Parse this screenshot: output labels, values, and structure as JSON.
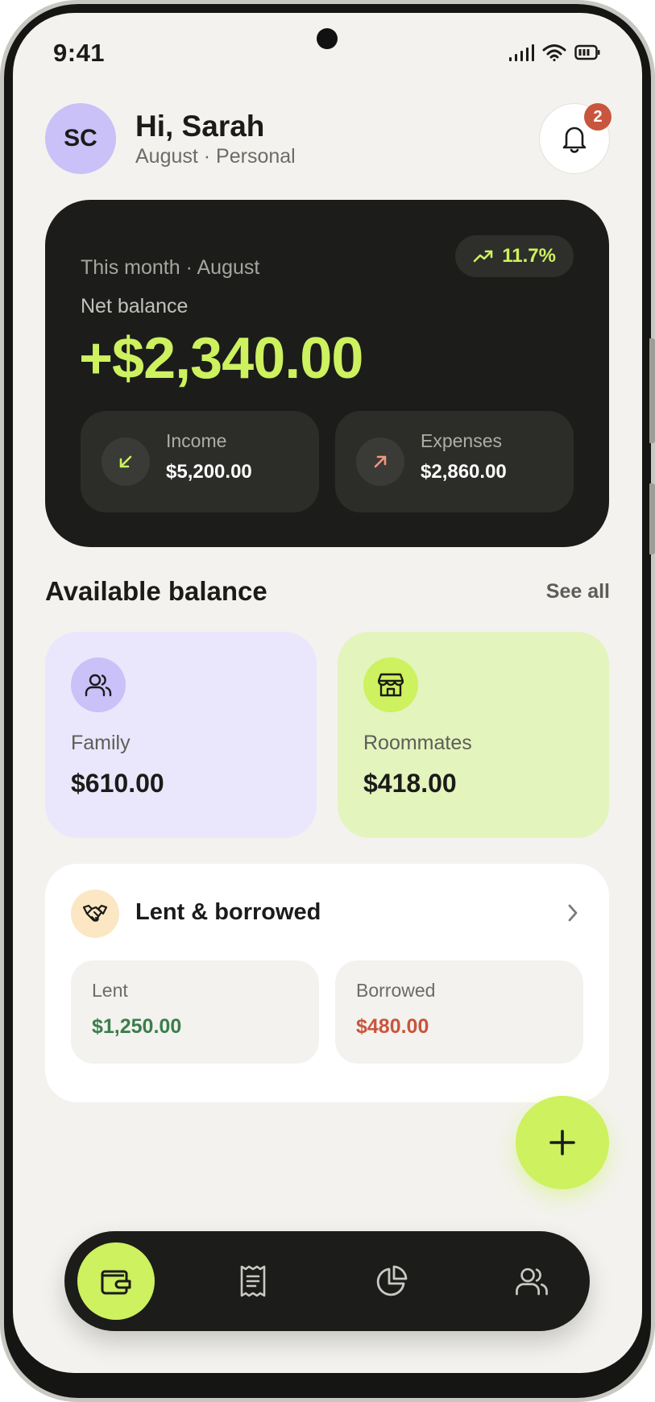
{
  "status_bar": {
    "time": "9:41"
  },
  "header": {
    "avatar_initials": "SC",
    "greeting": "Hi, Sarah",
    "subtitle": "August · Personal",
    "notification_count": "2"
  },
  "balance_card": {
    "period": "This month · August",
    "trend": "11.7%",
    "label": "Net balance",
    "amount": "+$2,340.00",
    "income": {
      "label": "Income",
      "value": "$5,200.00",
      "icon": "arrow-down-left-icon"
    },
    "expenses": {
      "label": "Expenses",
      "value": "$2,860.00",
      "icon": "arrow-up-right-icon"
    }
  },
  "available": {
    "title": "Available balance",
    "see_all": "See all",
    "wallets": [
      {
        "name": "Family",
        "amount": "$610.00",
        "icon": "users-icon"
      },
      {
        "name": "Roommates",
        "amount": "$418.00",
        "icon": "store-icon"
      }
    ]
  },
  "lent_borrowed": {
    "title": "Lent & borrowed",
    "icon": "handshake-icon",
    "lent": {
      "label": "Lent",
      "value": "$1,250.00"
    },
    "borrowed": {
      "label": "Borrowed",
      "value": "$480.00"
    }
  },
  "nav": {
    "items": [
      {
        "name": "wallet",
        "icon": "wallet-icon",
        "active": true
      },
      {
        "name": "transactions",
        "icon": "receipt-icon",
        "active": false
      },
      {
        "name": "stats",
        "icon": "pie-chart-icon",
        "active": false
      },
      {
        "name": "groups",
        "icon": "users-icon",
        "active": false
      }
    ]
  },
  "colors": {
    "accent": "#cdf15f",
    "dark": "#1c1c1a",
    "background": "#f3f2ee",
    "lavender": "#c9c1f8",
    "danger": "#c8553d",
    "success": "#3b7d4c"
  }
}
